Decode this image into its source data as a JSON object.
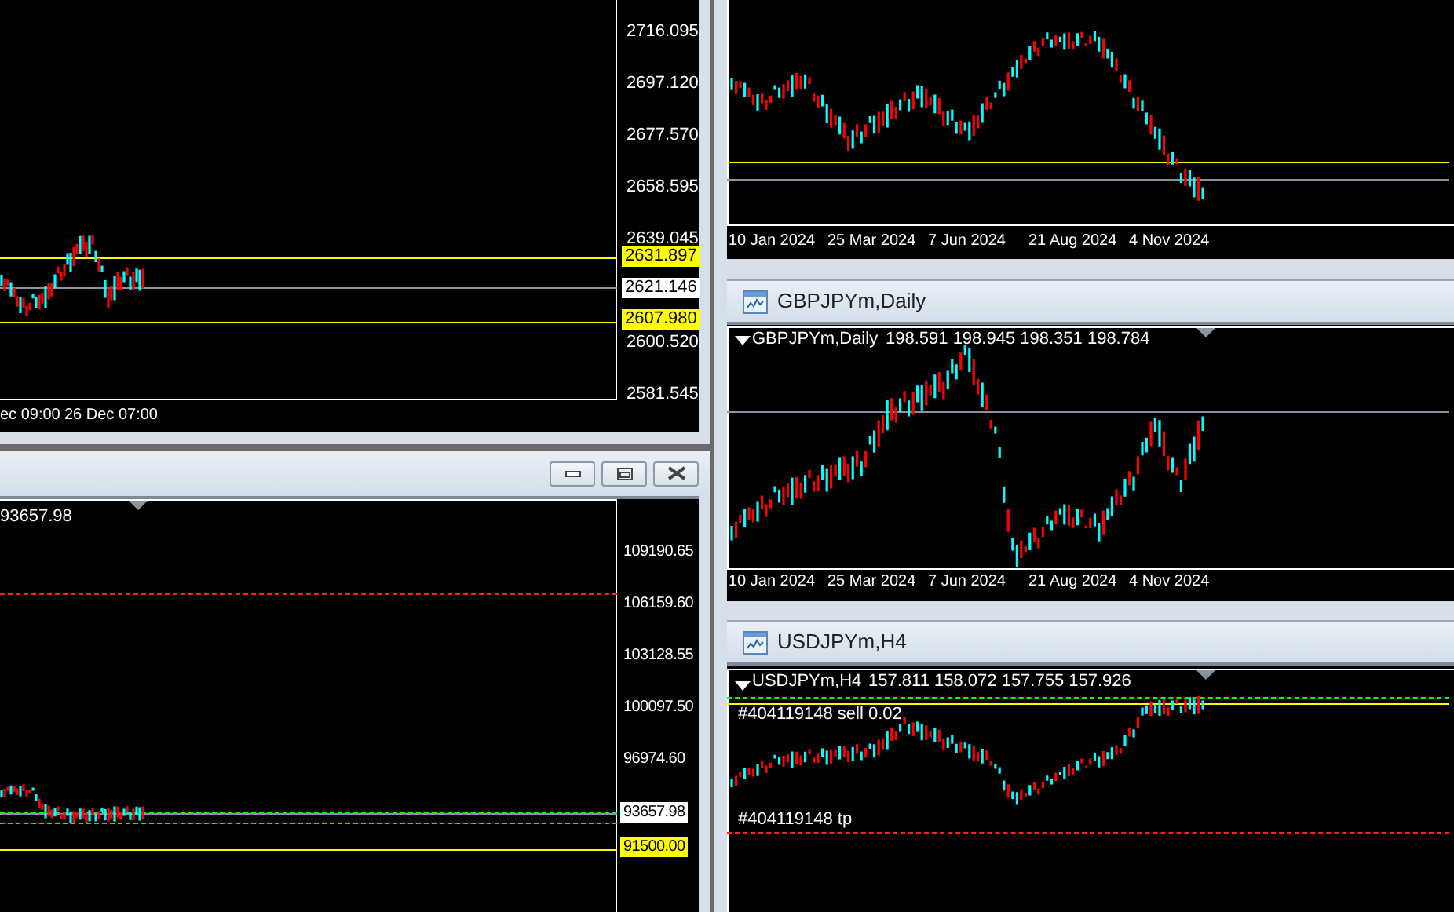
{
  "gold_chart": {
    "price_axis": [
      {
        "text": "2716.095",
        "kind": "tick"
      },
      {
        "text": "2697.120",
        "kind": "tick"
      },
      {
        "text": "2677.570",
        "kind": "tick"
      },
      {
        "text": "2658.595",
        "kind": "tick"
      },
      {
        "text": "2639.045",
        "kind": "tick"
      },
      {
        "text": "2631.897",
        "kind": "level"
      },
      {
        "text": "2621.146",
        "kind": "bid"
      },
      {
        "text": "2607.980",
        "kind": "level"
      },
      {
        "text": "2600.520",
        "kind": "tick"
      },
      {
        "text": "2581.545",
        "kind": "tick"
      }
    ],
    "time_axis": [
      "ec 09:00",
      "26 Dec 07:00"
    ]
  },
  "btc_window": {
    "buttons": [
      {
        "kind": "minimize"
      },
      {
        "kind": "restore"
      },
      {
        "kind": "close"
      }
    ],
    "quote": "93657.98",
    "price_axis": [
      {
        "text": "109190.65",
        "kind": "tick"
      },
      {
        "text": "106159.60",
        "kind": "tick"
      },
      {
        "text": "103128.55",
        "kind": "tick"
      },
      {
        "text": "100097.50",
        "kind": "tick"
      },
      {
        "text": "96974.60",
        "kind": "tick"
      },
      {
        "text": "93657.98",
        "kind": "bid"
      },
      {
        "text": "91500.00",
        "kind": "level"
      }
    ]
  },
  "eur_chart": {
    "time_axis": [
      "10 Jan 2024",
      "25 Mar 2024",
      "7 Jun 2024",
      "21 Aug 2024",
      "4 Nov 2024"
    ]
  },
  "gbp_window": {
    "title": "GBPJPYm,Daily",
    "symbol": "GBPJPYm,Daily",
    "quote": "198.591 198.945 198.351 198.784",
    "time_axis": [
      "10 Jan 2024",
      "25 Mar 2024",
      "7 Jun 2024",
      "21 Aug 2024",
      "4 Nov 2024"
    ]
  },
  "usd_window": {
    "title": "USDJPYm,H4",
    "symbol": "USDJPYm,H4",
    "quote": "157.811 158.072 157.755 157.926",
    "order_labels": [
      {
        "text": "#404119148 sell 0.02",
        "kind": "entry"
      },
      {
        "text": "#404119148 tp",
        "kind": "tp"
      }
    ]
  }
}
